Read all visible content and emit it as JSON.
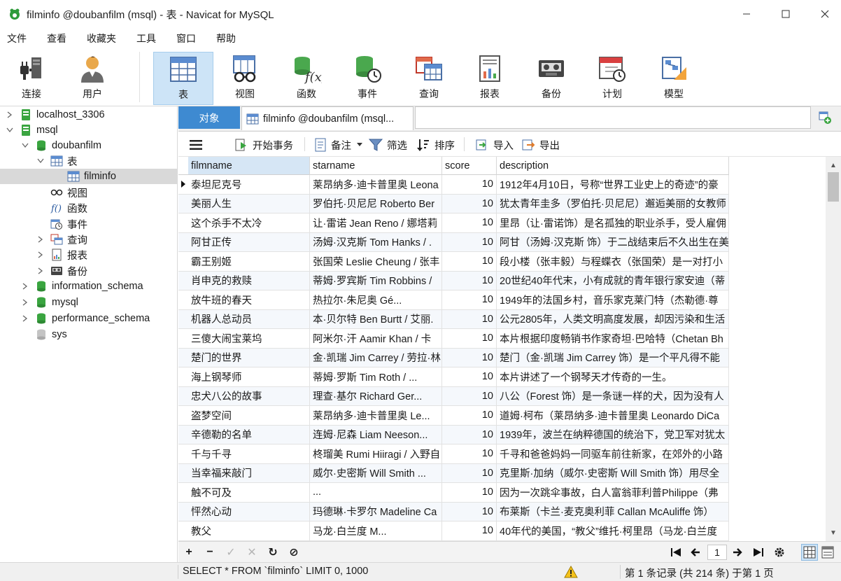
{
  "window": {
    "title": "filminfo @doubanfilm (msql) - 表 - Navicat for MySQL"
  },
  "menu": [
    "文件",
    "查看",
    "收藏夹",
    "工具",
    "窗口",
    "帮助"
  ],
  "toolbar": {
    "items": [
      {
        "label": "连接",
        "icon": "connection-icon"
      },
      {
        "label": "用户",
        "icon": "user-icon"
      },
      {
        "label": "表",
        "icon": "table-icon",
        "active": true
      },
      {
        "label": "视图",
        "icon": "view-icon"
      },
      {
        "label": "函数",
        "icon": "function-icon"
      },
      {
        "label": "事件",
        "icon": "event-icon"
      },
      {
        "label": "查询",
        "icon": "query-icon"
      },
      {
        "label": "报表",
        "icon": "report-icon"
      },
      {
        "label": "备份",
        "icon": "backup-icon"
      },
      {
        "label": "计划",
        "icon": "schedule-icon"
      },
      {
        "label": "模型",
        "icon": "model-icon"
      }
    ]
  },
  "tree": {
    "items": [
      {
        "label": "localhost_3306"
      },
      {
        "label": "msql"
      },
      {
        "label": "doubanfilm"
      },
      {
        "label": "表"
      },
      {
        "label": "filminfo"
      },
      {
        "label": "视图"
      },
      {
        "label": "函数"
      },
      {
        "label": "事件"
      },
      {
        "label": "查询"
      },
      {
        "label": "报表"
      },
      {
        "label": "备份"
      },
      {
        "label": "information_schema"
      },
      {
        "label": "mysql"
      },
      {
        "label": "performance_schema"
      },
      {
        "label": "sys"
      }
    ]
  },
  "tabs": {
    "objects": "对象",
    "doc": "filminfo @doubanfilm (msql..."
  },
  "subtoolbar": {
    "begin_transaction": "开始事务",
    "memo": "备注",
    "filter": "筛选",
    "sort": "排序",
    "import": "导入",
    "export": "导出"
  },
  "table": {
    "columns": [
      "filmname",
      "starname",
      "score",
      "description"
    ],
    "rows": [
      [
        "泰坦尼克号",
        "莱昂纳多·迪卡普里奥 Leona",
        "10",
        "1912年4月10日，号称“世界工业史上的奇迹”的豪"
      ],
      [
        "美丽人生",
        "罗伯托·贝尼尼 Roberto Ber",
        "10",
        "犹太青年圭多（罗伯托·贝尼尼）邂逅美丽的女教师"
      ],
      [
        "这个杀手不太冷",
        "让·雷诺 Jean Reno / 娜塔莉",
        "10",
        "里昂（让·雷诺饰）是名孤独的职业杀手，受人雇佣"
      ],
      [
        "阿甘正传",
        "汤姆·汉克斯 Tom Hanks / .",
        "10",
        "阿甘（汤姆·汉克斯 饰）于二战结束后不久出生在美"
      ],
      [
        "霸王别姬",
        "张国荣 Leslie Cheung / 张丰",
        "10",
        "段小楼（张丰毅）与程蝶衣（张国荣）是一对打小"
      ],
      [
        "肖申克的救赎",
        "蒂姆·罗宾斯 Tim Robbins /",
        "10",
        "20世纪40年代末，小有成就的青年银行家安迪（蒂"
      ],
      [
        "放牛班的春天",
        "热拉尔·朱尼奥 Gé...",
        "10",
        "1949年的法国乡村，音乐家克莱门特（杰勒德·尊"
      ],
      [
        "机器人总动员",
        "本·贝尔特 Ben Burtt / 艾丽.",
        "10",
        "公元2805年，人类文明高度发展，却因污染和生活"
      ],
      [
        "三傻大闹宝莱坞",
        "阿米尔·汗 Aamir Khan / 卡",
        "10",
        "本片根据印度畅销书作家奇坦·巴哈特（Chetan Bh"
      ],
      [
        "楚门的世界",
        "金·凯瑞 Jim Carrey / 劳拉·林",
        "10",
        "楚门（金·凯瑞 Jim Carrey 饰）是一个平凡得不能"
      ],
      [
        "海上钢琴师",
        "蒂姆·罗斯 Tim Roth / ...",
        "10",
        "本片讲述了一个钢琴天才传奇的一生。"
      ],
      [
        "忠犬八公的故事",
        "理查·基尔 Richard Ger...",
        "10",
        "八公（Forest 饰）是一条谜一样的犬，因为没有人"
      ],
      [
        "盗梦空间",
        "莱昂纳多·迪卡普里奥 Le...",
        "10",
        "道姆·柯布（莱昂纳多·迪卡普里奥 Leonardo DiCa"
      ],
      [
        "辛德勒的名单",
        "连姆·尼森 Liam Neeson...",
        "10",
        "1939年，波兰在纳粹德国的统治下，党卫军对犹太"
      ],
      [
        "千与千寻",
        "柊瑠美 Rumi Hiiragi / 入野自",
        "10",
        "千寻和爸爸妈妈一同驱车前往新家，在郊外的小路"
      ],
      [
        "当幸福来敲门",
        "威尔·史密斯 Will Smith ...",
        "10",
        "克里斯·加纳（威尔·史密斯 Will Smith 饰）用尽全"
      ],
      [
        "触不可及",
        "...",
        "10",
        "因为一次跳伞事故，白人富翁菲利普Philippe（弗"
      ],
      [
        "怦然心动",
        "玛德琳·卡罗尔 Madeline Ca",
        "10",
        "布莱斯（卡兰·麦克奥利菲 Callan McAuliffe 饰）"
      ],
      [
        "教父",
        "马龙·白兰度 M...",
        "10",
        "40年代的美国，“教父”维托·柯里昂（马龙·白兰度"
      ]
    ]
  },
  "navbar": {
    "page": "1"
  },
  "status": {
    "sql": "SELECT * FROM `filminfo` LIMIT 0, 1000",
    "records": "第 1 条记录 (共 214 条) 于第 1 页"
  },
  "colors": {
    "accent": "#3e8ad1",
    "active_tool": "#cde4f7",
    "db_green": "#3aa540"
  }
}
